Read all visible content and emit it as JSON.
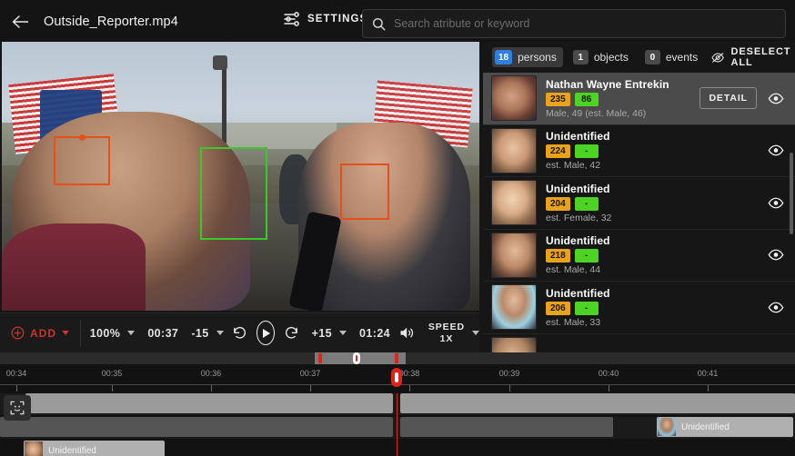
{
  "header": {
    "back_icon": "arrow-left-icon",
    "file_title": "Outside_Reporter.mp4",
    "settings_label": "SETTINGS",
    "settings_icon": "sliders-icon"
  },
  "search": {
    "icon": "search-icon",
    "placeholder": "Search atribute or keyword",
    "value": ""
  },
  "tabs": [
    {
      "count": "18",
      "label": "persons",
      "active": true
    },
    {
      "count": "1",
      "label": "objects",
      "active": false
    },
    {
      "count": "0",
      "label": "events",
      "active": false
    }
  ],
  "deselect": {
    "label": "DESELECT ALL",
    "icon": "eye-off-icon"
  },
  "persons": [
    {
      "name": "Nathan Wayne Entrekin",
      "badge_amber": "235",
      "badge_green": "86",
      "meta": "Male, 49 (est. Male, 46)",
      "detail_label": "DETAIL",
      "selected": true,
      "eye_icon": "eye-icon"
    },
    {
      "name": "Unidentified",
      "badge_amber": "224",
      "badge_green": "-",
      "meta": "est. Male, 42",
      "detail_label": "",
      "selected": false,
      "eye_icon": "eye-icon"
    },
    {
      "name": "Unidentified",
      "badge_amber": "204",
      "badge_green": "-",
      "meta": "est. Female, 32",
      "detail_label": "",
      "selected": false,
      "eye_icon": "eye-icon"
    },
    {
      "name": "Unidentified",
      "badge_amber": "218",
      "badge_green": "-",
      "meta": "est. Male, 44",
      "detail_label": "",
      "selected": false,
      "eye_icon": "eye-icon"
    },
    {
      "name": "Unidentified",
      "badge_amber": "206",
      "badge_green": "-",
      "meta": "est. Male, 33",
      "detail_label": "",
      "selected": false,
      "eye_icon": "eye-icon"
    }
  ],
  "controls": {
    "add_label": "ADD",
    "add_icon": "plus-circle-icon",
    "zoom_level": "100%",
    "current_time": "00:37",
    "back_15": "-15",
    "rewind_icon": "rotate-ccw-icon",
    "play_icon": "play-icon",
    "forward_icon": "rotate-cw-icon",
    "fwd_15": "+15",
    "total_time": "01:24",
    "volume_icon": "volume-icon",
    "speed_label": "SPEED",
    "speed_value": "1X"
  },
  "timeline": {
    "ticks": [
      "00:34",
      "00:35",
      "00:36",
      "00:37",
      "00:38",
      "00:39",
      "00:40",
      "00:41"
    ],
    "playhead_time": "00:37.8",
    "track_icon": "face-scan-icon",
    "chips": [
      {
        "label": "Unidentified",
        "track": 2
      },
      {
        "label": "Unidentified",
        "track": 3
      }
    ]
  },
  "colors": {
    "accent_red": "#c8362b",
    "badge_amber": "#e8a21c",
    "badge_green": "#4cd324",
    "tab_blue": "#2f7fe0",
    "playhead": "#e0241c",
    "bbox_green": "#3ec728",
    "bbox_orange": "#e2511b"
  }
}
